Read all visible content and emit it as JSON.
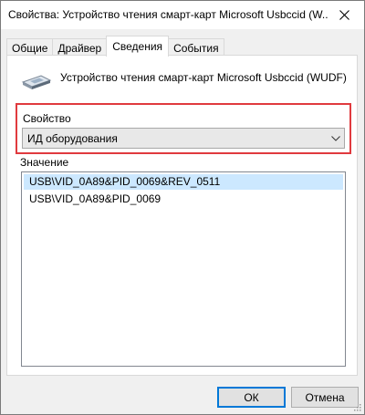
{
  "window": {
    "title": "Свойства: Устройство чтения смарт-карт Microsoft Usbccid (W..."
  },
  "tabs": [
    {
      "label": "Общие"
    },
    {
      "label": "Драйвер"
    },
    {
      "label": "Сведения",
      "active": true
    },
    {
      "label": "События"
    }
  ],
  "device": {
    "name": "Устройство чтения смарт-карт Microsoft Usbccid (WUDF)",
    "icon": "smartcard-reader-icon"
  },
  "property": {
    "label": "Свойство",
    "selected": "ИД оборудования"
  },
  "value": {
    "label": "Значение",
    "items": [
      "USB\\VID_0A89&PID_0069&REV_0511",
      "USB\\VID_0A89&PID_0069"
    ],
    "selected_index": 0
  },
  "buttons": {
    "ok": "ОК",
    "cancel": "Отмена"
  },
  "colors": {
    "highlight_border": "#e03a3e",
    "selection": "#cce8ff",
    "ok_border": "#0078d7"
  }
}
